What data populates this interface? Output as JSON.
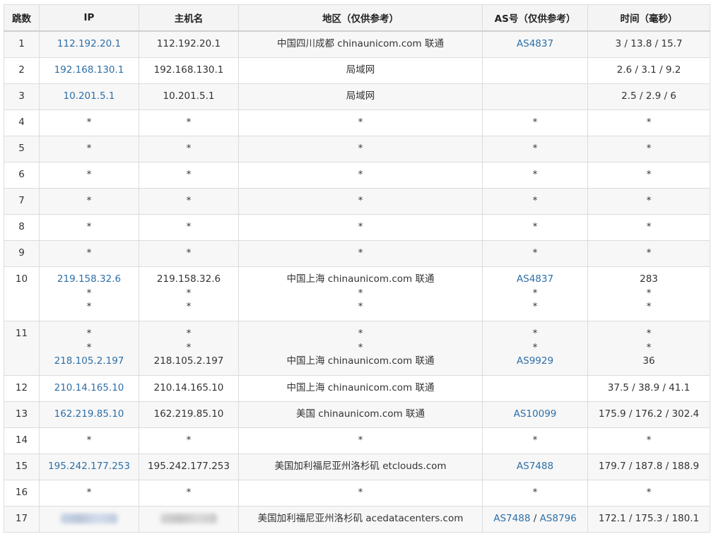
{
  "header": {
    "hop": "跳数",
    "ip": "IP",
    "hostname": "主机名",
    "region": "地区（仅供参考）",
    "as": "AS号（仅供参考）",
    "time": "时间（毫秒）"
  },
  "rows": [
    {
      "hop": "1",
      "ip": [
        "112.192.20.1"
      ],
      "host": [
        "112.192.20.1"
      ],
      "region": [
        "中国四川成都 chinaunicom.com 联通"
      ],
      "as": [
        [
          "AS4837"
        ]
      ],
      "time": [
        "3 / 13.8 / 15.7"
      ]
    },
    {
      "hop": "2",
      "ip": [
        "192.168.130.1"
      ],
      "host": [
        "192.168.130.1"
      ],
      "region": [
        "局域网"
      ],
      "as": [
        []
      ],
      "time": [
        "2.6 / 3.1 / 9.2"
      ]
    },
    {
      "hop": "3",
      "ip": [
        "10.201.5.1"
      ],
      "host": [
        "10.201.5.1"
      ],
      "region": [
        "局域网"
      ],
      "as": [
        []
      ],
      "time": [
        "2.5 / 2.9 / 6"
      ]
    },
    {
      "hop": "4",
      "ip": [
        "*"
      ],
      "host": [
        "*"
      ],
      "region": [
        "*"
      ],
      "as": [
        [
          "*"
        ]
      ],
      "time": [
        "*"
      ]
    },
    {
      "hop": "5",
      "ip": [
        "*"
      ],
      "host": [
        "*"
      ],
      "region": [
        "*"
      ],
      "as": [
        [
          "*"
        ]
      ],
      "time": [
        "*"
      ]
    },
    {
      "hop": "6",
      "ip": [
        "*"
      ],
      "host": [
        "*"
      ],
      "region": [
        "*"
      ],
      "as": [
        [
          "*"
        ]
      ],
      "time": [
        "*"
      ]
    },
    {
      "hop": "7",
      "ip": [
        "*"
      ],
      "host": [
        "*"
      ],
      "region": [
        "*"
      ],
      "as": [
        [
          "*"
        ]
      ],
      "time": [
        "*"
      ]
    },
    {
      "hop": "8",
      "ip": [
        "*"
      ],
      "host": [
        "*"
      ],
      "region": [
        "*"
      ],
      "as": [
        [
          "*"
        ]
      ],
      "time": [
        "*"
      ]
    },
    {
      "hop": "9",
      "ip": [
        "*"
      ],
      "host": [
        "*"
      ],
      "region": [
        "*"
      ],
      "as": [
        [
          "*"
        ]
      ],
      "time": [
        "*"
      ]
    },
    {
      "hop": "10",
      "ip": [
        "219.158.32.6",
        "*",
        "*"
      ],
      "host": [
        "219.158.32.6",
        "*",
        "*"
      ],
      "region": [
        "中国上海 chinaunicom.com 联通",
        "*",
        "*"
      ],
      "as": [
        [
          "AS4837"
        ],
        [
          "*"
        ],
        [
          "*"
        ]
      ],
      "time": [
        "283",
        "*",
        "*"
      ]
    },
    {
      "hop": "11",
      "ip": [
        "*",
        "*",
        "218.105.2.197"
      ],
      "host": [
        "*",
        "*",
        "218.105.2.197"
      ],
      "region": [
        "*",
        "*",
        "中国上海 chinaunicom.com 联通"
      ],
      "as": [
        [
          "*"
        ],
        [
          "*"
        ],
        [
          "AS9929"
        ]
      ],
      "time": [
        "*",
        "*",
        "36"
      ]
    },
    {
      "hop": "12",
      "ip": [
        "210.14.165.10"
      ],
      "host": [
        "210.14.165.10"
      ],
      "region": [
        "中国上海 chinaunicom.com 联通"
      ],
      "as": [
        []
      ],
      "time": [
        "37.5 / 38.9 / 41.1"
      ]
    },
    {
      "hop": "13",
      "ip": [
        "162.219.85.10"
      ],
      "host": [
        "162.219.85.10"
      ],
      "region": [
        "美国 chinaunicom.com 联通"
      ],
      "as": [
        [
          "AS10099"
        ]
      ],
      "time": [
        "175.9 / 176.2 / 302.4"
      ]
    },
    {
      "hop": "14",
      "ip": [
        "*"
      ],
      "host": [
        "*"
      ],
      "region": [
        "*"
      ],
      "as": [
        [
          "*"
        ]
      ],
      "time": [
        "*"
      ]
    },
    {
      "hop": "15",
      "ip": [
        "195.242.177.253"
      ],
      "host": [
        "195.242.177.253"
      ],
      "region": [
        "美国加利福尼亚州洛杉矶 etclouds.com"
      ],
      "as": [
        [
          "AS7488"
        ]
      ],
      "time": [
        "179.7 / 187.8 / 188.9"
      ]
    },
    {
      "hop": "16",
      "ip": [
        "*"
      ],
      "host": [
        "*"
      ],
      "region": [
        "*"
      ],
      "as": [
        [
          "*"
        ]
      ],
      "time": [
        "*"
      ]
    },
    {
      "hop": "17",
      "ip": [
        null
      ],
      "host": [
        null
      ],
      "region": [
        "美国加利福尼亚州洛杉矶 acedatacenters.com"
      ],
      "as": [
        [
          "AS7488",
          "AS8796"
        ]
      ],
      "time": [
        "172.1 / 175.3 / 180.1"
      ]
    }
  ]
}
